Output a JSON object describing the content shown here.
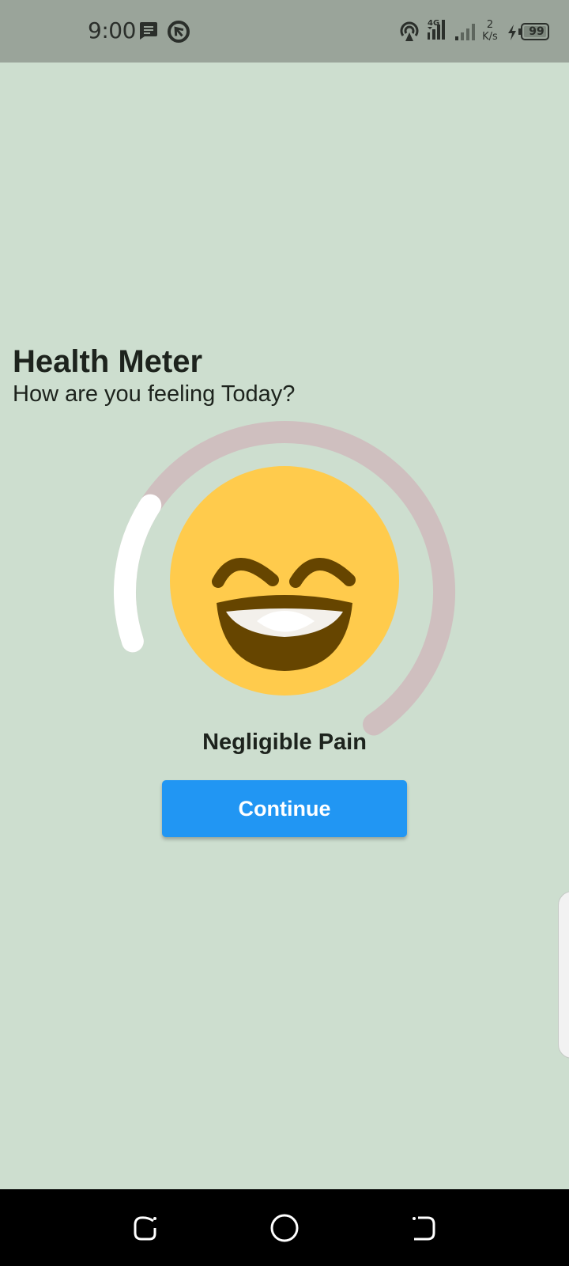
{
  "status_bar": {
    "time": "9:00",
    "network_type": "4G",
    "speed_value": "2",
    "speed_unit": "K/s",
    "battery": "99",
    "icons": [
      "message-icon",
      "sync-icon",
      "hotspot-icon",
      "signal-icon",
      "signal-weak-icon",
      "charging-icon",
      "battery-icon"
    ]
  },
  "header": {
    "title": "Health Meter",
    "subtitle": "How are you feeling Today?"
  },
  "meter": {
    "level_fraction": 0.2,
    "emoji": "grinning-face-icon",
    "status_label": "Negligible Pain"
  },
  "actions": {
    "continue_label": "Continue"
  },
  "navigation": {
    "items": [
      "recents-button",
      "home-button",
      "back-button"
    ]
  },
  "colors": {
    "background": "#cddecf",
    "status_bar": "#9aa49a",
    "meter_track": "#cfbfbf",
    "meter_fill": "#ffffff",
    "emoji_face": "#ffcb4c",
    "emoji_mouth": "#664500",
    "button": "#2196f3",
    "text": "#1d231d"
  }
}
